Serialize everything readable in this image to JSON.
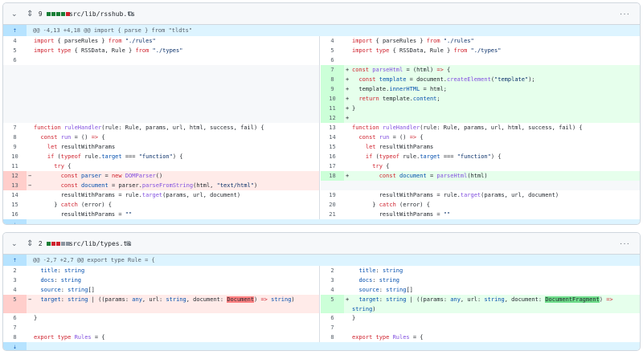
{
  "files": [
    {
      "change_count": "9",
      "diffstat": [
        "#1a7f37",
        "#1a7f37",
        "#1a7f37",
        "#1a7f37",
        "#cf222e"
      ],
      "name": "src/lib/rsshub.ts",
      "hunk_header": "@@ -4,13 +4,18 @@ import { parse } from \"tldts\""
    },
    {
      "change_count": "2",
      "diffstat": [
        "#1a7f37",
        "#cf222e",
        "#cf222e",
        "#8c959f",
        "#8c959f"
      ],
      "name": "src/lib/types.ts",
      "hunk_header": "@@ -2,7 +2,7 @@ export type Rule = {"
    }
  ],
  "icons": {
    "collapse": "chevron-collapse-icon",
    "expand": "unfold-icon",
    "copy": "copy-icon",
    "more": "kebab-horizontal-icon",
    "expand_up": "expand-up-icon",
    "expand_down": "expand-down-icon"
  },
  "colors": {
    "addition": "#e6ffec",
    "deletion": "#ffebe9",
    "hunk": "#ddf4ff"
  },
  "rows1": [
    {
      "l_num": "4",
      "l": "import { parseRules } from \"./rules\"",
      "r_num": "4",
      "r": "import { parseRules } from \"./rules\""
    },
    {
      "l_num": "5",
      "l": "import type { RSSData, Rule } from \"./types\"",
      "r_num": "5",
      "r": "import type { RSSData, Rule } from \"./types\""
    },
    {
      "l_num": "6",
      "l": "",
      "r_num": "6",
      "r": ""
    },
    {
      "r_num": "7",
      "r_sign": "+",
      "r": "const parseHtml = (html) => {"
    },
    {
      "r_num": "8",
      "r_sign": "+",
      "r": "  const template = document.createElement(\"template\");"
    },
    {
      "r_num": "9",
      "r_sign": "+",
      "r": "  template.innerHTML = html;"
    },
    {
      "r_num": "10",
      "r_sign": "+",
      "r": "  return template.content;"
    },
    {
      "r_num": "11",
      "r_sign": "+",
      "r": "}"
    },
    {
      "r_num": "12",
      "r_sign": "+",
      "r": ""
    },
    {
      "l_num": "7",
      "l": "function ruleHandler(rule: Rule, params, url, html, success, fail) {",
      "r_num": "13",
      "r": "function ruleHandler(rule: Rule, params, url, html, success, fail) {"
    },
    {
      "l_num": "8",
      "l": "  const run = () => {",
      "r_num": "14",
      "r": "  const run = () => {"
    },
    {
      "l_num": "9",
      "l": "    let resultWithParams",
      "r_num": "15",
      "r": "    let resultWithParams"
    },
    {
      "l_num": "10",
      "l": "    if (typeof rule.target === \"function\") {",
      "r_num": "16",
      "r": "    if (typeof rule.target === \"function\") {"
    },
    {
      "l_num": "11",
      "l": "      try {",
      "r_num": "17",
      "r": "      try {"
    },
    {
      "l_num": "12",
      "l_sign": "−",
      "l": "        const parser = new DOMParser()",
      "r_num": "18",
      "r_sign": "+",
      "r": "        const document = parseHtml(html)"
    },
    {
      "l_num": "13",
      "l_sign": "−",
      "l": "        const document = parser.parseFromString(html, \"text/html\")"
    },
    {
      "l_num": "14",
      "l": "        resultWithParams = rule.target(params, url, document)",
      "r_num": "19",
      "r": "        resultWithParams = rule.target(params, url, document)"
    },
    {
      "l_num": "15",
      "l": "      } catch (error) {",
      "r_num": "20",
      "r": "      } catch (error) {"
    },
    {
      "l_num": "16",
      "l": "        resultWithParams = \"\"",
      "r_num": "21",
      "r": "        resultWithParams = \"\""
    }
  ],
  "rows2": [
    {
      "l_num": "2",
      "l": "  title: string",
      "r_num": "2",
      "r": "  title: string"
    },
    {
      "l_num": "3",
      "l": "  docs: string",
      "r_num": "3",
      "r": "  docs: string"
    },
    {
      "l_num": "4",
      "l": "  source: string[]",
      "r_num": "4",
      "r": "  source: string[]"
    },
    {
      "l_num": "5",
      "l_sign": "−",
      "l": "  target: string | ((params: any, url: string, document: Document) => string)",
      "r_num": "5",
      "r_sign": "+",
      "r": "  target: string | ((params: any, url: string, document: DocumentFragment) =>",
      "r2": "string)"
    },
    {
      "l_num": "6",
      "l": "}",
      "r_num": "6",
      "r": "}"
    },
    {
      "l_num": "7",
      "l": "",
      "r_num": "7",
      "r": ""
    },
    {
      "l_num": "8",
      "l": "export type Rules = {",
      "r_num": "8",
      "r": "export type Rules = {"
    }
  ]
}
